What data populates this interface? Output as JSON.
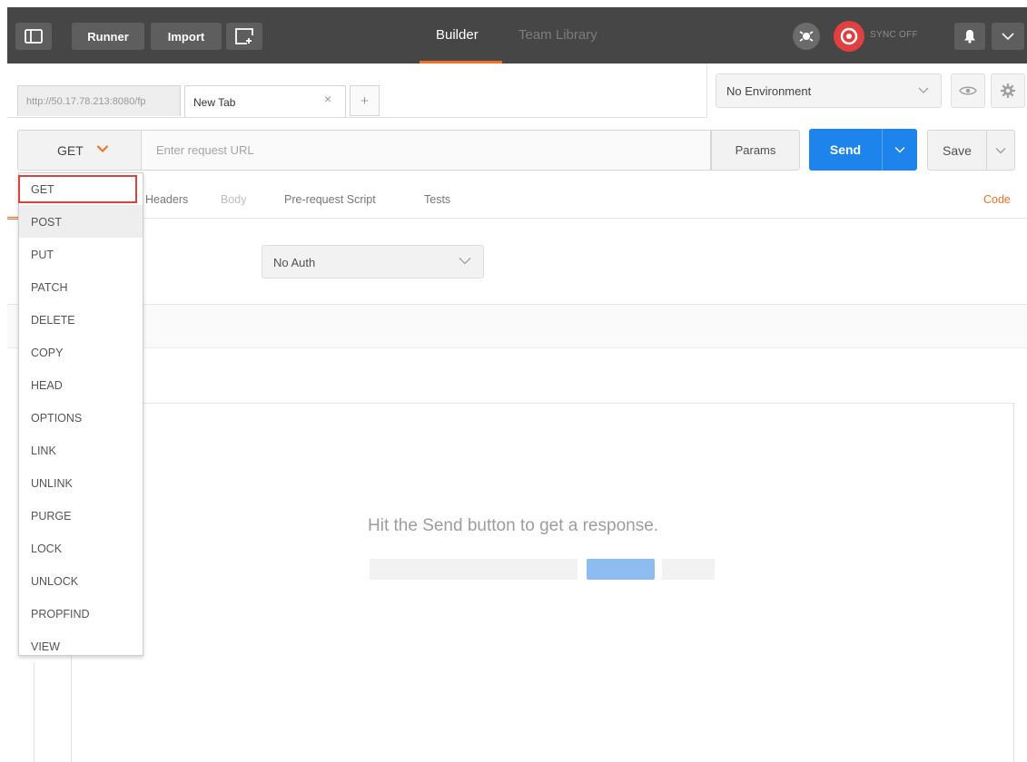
{
  "header": {
    "runner_label": "Runner",
    "import_label": "Import",
    "builder_label": "Builder",
    "team_library_label": "Team Library",
    "sync_label": "SYNC OFF",
    "accent_color": "#f47023",
    "icons": [
      "sidebar-toggle-icon",
      "new-window-icon",
      "interceptor-icon",
      "sync-icon",
      "bell-icon",
      "chevron-down-icon"
    ]
  },
  "tabs": {
    "items": [
      {
        "label": "http://50.17.78.213:8080/fp",
        "active": false
      },
      {
        "label": "New Tab",
        "active": true
      }
    ],
    "close_glyph": "×",
    "add_glyph": "+"
  },
  "environment": {
    "selected": "No Environment"
  },
  "request": {
    "method": "GET",
    "url_value": "",
    "url_placeholder": "Enter request URL",
    "params_label": "Params",
    "send_label": "Send",
    "save_label": "Save",
    "send_color": "#1d84eb"
  },
  "subtabs": {
    "headers": "Headers",
    "body": "Body",
    "prerequest": "Pre-request Script",
    "tests": "Tests",
    "code": "Code"
  },
  "auth": {
    "selected": "No Auth"
  },
  "response": {
    "empty_message": "Hit the Send button to get a response."
  },
  "method_dropdown": {
    "items": [
      "GET",
      "POST",
      "PUT",
      "PATCH",
      "DELETE",
      "COPY",
      "HEAD",
      "OPTIONS",
      "LINK",
      "UNLINK",
      "PURGE",
      "LOCK",
      "UNLOCK",
      "PROPFIND",
      "VIEW"
    ],
    "highlighted": "GET",
    "hovered": "POST",
    "highlight_color": "#e0403f"
  }
}
